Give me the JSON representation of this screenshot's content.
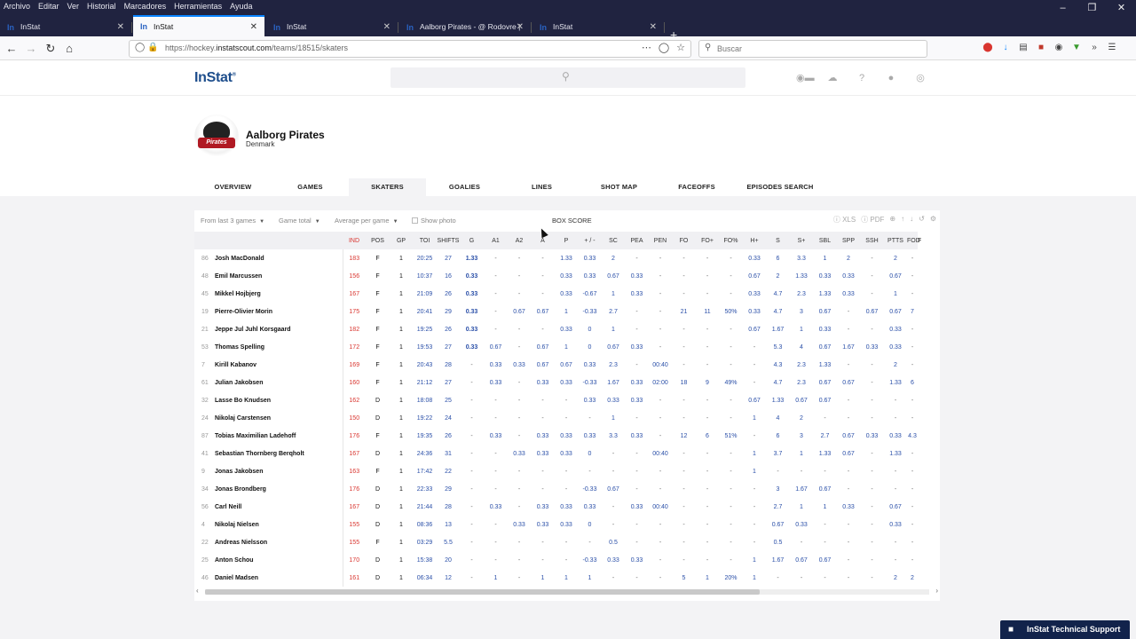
{
  "browser": {
    "menu": [
      "Archivo",
      "Editar",
      "Ver",
      "Historial",
      "Marcadores",
      "Herramientas",
      "Ayuda"
    ],
    "tabs": [
      {
        "title": "InStat",
        "active": false
      },
      {
        "title": "InStat",
        "active": true
      },
      {
        "title": "InStat",
        "active": false
      },
      {
        "title": "Aalborg Pirates - @ Rodovre |",
        "active": false
      },
      {
        "title": "InStat",
        "active": false
      }
    ],
    "url_prefix": "https://hockey.",
    "url_domain": "instatscout.com",
    "url_path": "/teams/18515/skaters",
    "search_placeholder": "Buscar",
    "accent": "#0a84ff",
    "chrome_bg": "#202340"
  },
  "site": {
    "logo": "InStat",
    "logo_mark": "®",
    "brand_color": "#1e4e8c"
  },
  "team": {
    "name": "Aalborg Pirates",
    "country": "Denmark",
    "logo_word": "Pirates"
  },
  "nav_tabs": [
    "OVERVIEW",
    "GAMES",
    "SKATERS",
    "GOALIES",
    "LINES",
    "SHOT MAP",
    "FACEOFFS",
    "EPISODES SEARCH"
  ],
  "active_tab": "SKATERS",
  "toolbar": {
    "filter_range": "From last 3 games",
    "filter_total": "Game total",
    "filter_avg": "Average per game",
    "show_photo": "Show photo",
    "box_score": "BOX SCORE",
    "xls": "XLS",
    "pdf": "PDF"
  },
  "table": {
    "columns": [
      "IND",
      "POS",
      "GP",
      "TOI",
      "SHIFTS",
      "G",
      "A1",
      "A2",
      "A",
      "P",
      "+ / -",
      "SC",
      "PEA",
      "PEN",
      "FO",
      "FO+",
      "FO%",
      "H+",
      "S",
      "S+",
      "SBL",
      "SPP",
      "SSH",
      "PTTS",
      "FOD",
      "F"
    ],
    "rows": [
      {
        "num": "86",
        "name": "Josh MacDonald",
        "cells": [
          "183",
          "F",
          "1",
          "20:25",
          "27",
          "1.33",
          "-",
          "-",
          "-",
          "1.33",
          "0.33",
          "2",
          "-",
          "-",
          "-",
          "-",
          "-",
          "0.33",
          "6",
          "3.3",
          "1",
          "2",
          "-",
          "2",
          "-",
          ""
        ]
      },
      {
        "num": "48",
        "name": "Emil Marcussen",
        "cells": [
          "156",
          "F",
          "1",
          "10:37",
          "16",
          "0.33",
          "-",
          "-",
          "-",
          "0.33",
          "0.33",
          "0.67",
          "0.33",
          "-",
          "-",
          "-",
          "-",
          "0.67",
          "2",
          "1.33",
          "0.33",
          "0.33",
          "-",
          "0.67",
          "-",
          ""
        ]
      },
      {
        "num": "45",
        "name": "Mikkel Hojbjerg",
        "cells": [
          "167",
          "F",
          "1",
          "21:09",
          "26",
          "0.33",
          "-",
          "-",
          "-",
          "0.33",
          "-0.67",
          "1",
          "0.33",
          "-",
          "-",
          "-",
          "-",
          "0.33",
          "4.7",
          "2.3",
          "1.33",
          "0.33",
          "-",
          "1",
          "-",
          ""
        ]
      },
      {
        "num": "19",
        "name": "Pierre-Olivier Morin",
        "cells": [
          "175",
          "F",
          "1",
          "20:41",
          "29",
          "0.33",
          "-",
          "0.67",
          "0.67",
          "1",
          "-0.33",
          "2.7",
          "-",
          "-",
          "21",
          "11",
          "50%",
          "0.33",
          "4.7",
          "3",
          "0.67",
          "-",
          "0.67",
          "0.67",
          "7",
          ""
        ]
      },
      {
        "num": "21",
        "name": "Jeppe Jul Juhl Korsgaard",
        "cells": [
          "182",
          "F",
          "1",
          "19:25",
          "26",
          "0.33",
          "-",
          "-",
          "-",
          "0.33",
          "0",
          "1",
          "-",
          "-",
          "-",
          "-",
          "-",
          "0.67",
          "1.67",
          "1",
          "0.33",
          "-",
          "-",
          "0.33",
          "-",
          ""
        ]
      },
      {
        "num": "53",
        "name": "Thomas Spelling",
        "cells": [
          "172",
          "F",
          "1",
          "19:53",
          "27",
          "0.33",
          "0.67",
          "-",
          "0.67",
          "1",
          "0",
          "0.67",
          "0.33",
          "-",
          "-",
          "-",
          "-",
          "-",
          "5.3",
          "4",
          "0.67",
          "1.67",
          "0.33",
          "0.33",
          "-",
          ""
        ]
      },
      {
        "num": "7",
        "name": "Kirill Kabanov",
        "cells": [
          "169",
          "F",
          "1",
          "20:43",
          "28",
          "-",
          "0.33",
          "0.33",
          "0.67",
          "0.67",
          "0.33",
          "2.3",
          "-",
          "00:40",
          "-",
          "-",
          "-",
          "-",
          "4.3",
          "2.3",
          "1.33",
          "-",
          "-",
          "2",
          "-",
          ""
        ]
      },
      {
        "num": "61",
        "name": "Julian Jakobsen",
        "cells": [
          "160",
          "F",
          "1",
          "21:12",
          "27",
          "-",
          "0.33",
          "-",
          "0.33",
          "0.33",
          "-0.33",
          "1.67",
          "0.33",
          "02:00",
          "18",
          "9",
          "49%",
          "-",
          "4.7",
          "2.3",
          "0.67",
          "0.67",
          "-",
          "1.33",
          "6",
          ""
        ]
      },
      {
        "num": "32",
        "name": "Lasse Bo Knudsen",
        "cells": [
          "162",
          "D",
          "1",
          "18:08",
          "25",
          "-",
          "-",
          "-",
          "-",
          "-",
          "0.33",
          "0.33",
          "0.33",
          "-",
          "-",
          "-",
          "-",
          "0.67",
          "1.33",
          "0.67",
          "0.67",
          "-",
          "-",
          "-",
          "-",
          ""
        ]
      },
      {
        "num": "24",
        "name": "Nikolaj Carstensen",
        "cells": [
          "150",
          "D",
          "1",
          "19:22",
          "24",
          "-",
          "-",
          "-",
          "-",
          "-",
          "-",
          "1",
          "-",
          "-",
          "-",
          "-",
          "-",
          "1",
          "4",
          "2",
          "-",
          "-",
          "-",
          "-",
          "-",
          ""
        ]
      },
      {
        "num": "87",
        "name": "Tobias Maximilian Ladehoff",
        "cells": [
          "176",
          "F",
          "1",
          "19:35",
          "26",
          "-",
          "0.33",
          "-",
          "0.33",
          "0.33",
          "0.33",
          "3.3",
          "0.33",
          "-",
          "12",
          "6",
          "51%",
          "-",
          "6",
          "3",
          "2.7",
          "0.67",
          "0.33",
          "0.33",
          "4.3",
          ""
        ]
      },
      {
        "num": "41",
        "name": "Sebastian Thornberg Berqholt",
        "cells": [
          "167",
          "D",
          "1",
          "24:36",
          "31",
          "-",
          "-",
          "0.33",
          "0.33",
          "0.33",
          "0",
          "-",
          "-",
          "00:40",
          "-",
          "-",
          "-",
          "1",
          "3.7",
          "1",
          "1.33",
          "0.67",
          "-",
          "1.33",
          "-",
          ""
        ]
      },
      {
        "num": "9",
        "name": "Jonas Jakobsen",
        "cells": [
          "163",
          "F",
          "1",
          "17:42",
          "22",
          "-",
          "-",
          "-",
          "-",
          "-",
          "-",
          "-",
          "-",
          "-",
          "-",
          "-",
          "-",
          "1",
          "-",
          "-",
          "-",
          "-",
          "-",
          "-",
          "-",
          ""
        ]
      },
      {
        "num": "34",
        "name": "Jonas Brondberg",
        "cells": [
          "176",
          "D",
          "1",
          "22:33",
          "29",
          "-",
          "-",
          "-",
          "-",
          "-",
          "-0.33",
          "0.67",
          "-",
          "-",
          "-",
          "-",
          "-",
          "-",
          "3",
          "1.67",
          "0.67",
          "-",
          "-",
          "-",
          "-",
          ""
        ]
      },
      {
        "num": "56",
        "name": "Carl Neill",
        "cells": [
          "167",
          "D",
          "1",
          "21:44",
          "28",
          "-",
          "0.33",
          "-",
          "0.33",
          "0.33",
          "0.33",
          "-",
          "0.33",
          "00:40",
          "-",
          "-",
          "-",
          "-",
          "2.7",
          "1",
          "1",
          "0.33",
          "-",
          "0.67",
          "-",
          ""
        ]
      },
      {
        "num": "4",
        "name": "Nikolaj Nielsen",
        "cells": [
          "155",
          "D",
          "1",
          "08:36",
          "13",
          "-",
          "-",
          "0.33",
          "0.33",
          "0.33",
          "0",
          "-",
          "-",
          "-",
          "-",
          "-",
          "-",
          "-",
          "0.67",
          "0.33",
          "-",
          "-",
          "-",
          "0.33",
          "-",
          ""
        ]
      },
      {
        "num": "22",
        "name": "Andreas Nielsson",
        "cells": [
          "155",
          "F",
          "1",
          "03:29",
          "5.5",
          "-",
          "-",
          "-",
          "-",
          "-",
          "-",
          "0.5",
          "-",
          "-",
          "-",
          "-",
          "-",
          "-",
          "0.5",
          "-",
          "-",
          "-",
          "-",
          "-",
          "-",
          ""
        ]
      },
      {
        "num": "25",
        "name": "Anton Schou",
        "cells": [
          "170",
          "D",
          "1",
          "15:38",
          "20",
          "-",
          "-",
          "-",
          "-",
          "-",
          "-0.33",
          "0.33",
          "0.33",
          "-",
          "-",
          "-",
          "-",
          "1",
          "1.67",
          "0.67",
          "0.67",
          "-",
          "-",
          "-",
          "-",
          ""
        ]
      },
      {
        "num": "46",
        "name": "Daniel Madsen",
        "cells": [
          "161",
          "D",
          "1",
          "06:34",
          "12",
          "-",
          "1",
          "-",
          "1",
          "1",
          "1",
          "-",
          "-",
          "-",
          "5",
          "1",
          "20%",
          "1",
          "-",
          "-",
          "-",
          "-",
          "-",
          "2",
          "2",
          ""
        ]
      }
    ]
  },
  "support_label": "InStat Technical Support",
  "colors": {
    "ind_red": "#d9352f",
    "value_blue": "#2a4fa8",
    "support_bg": "#12234b"
  }
}
